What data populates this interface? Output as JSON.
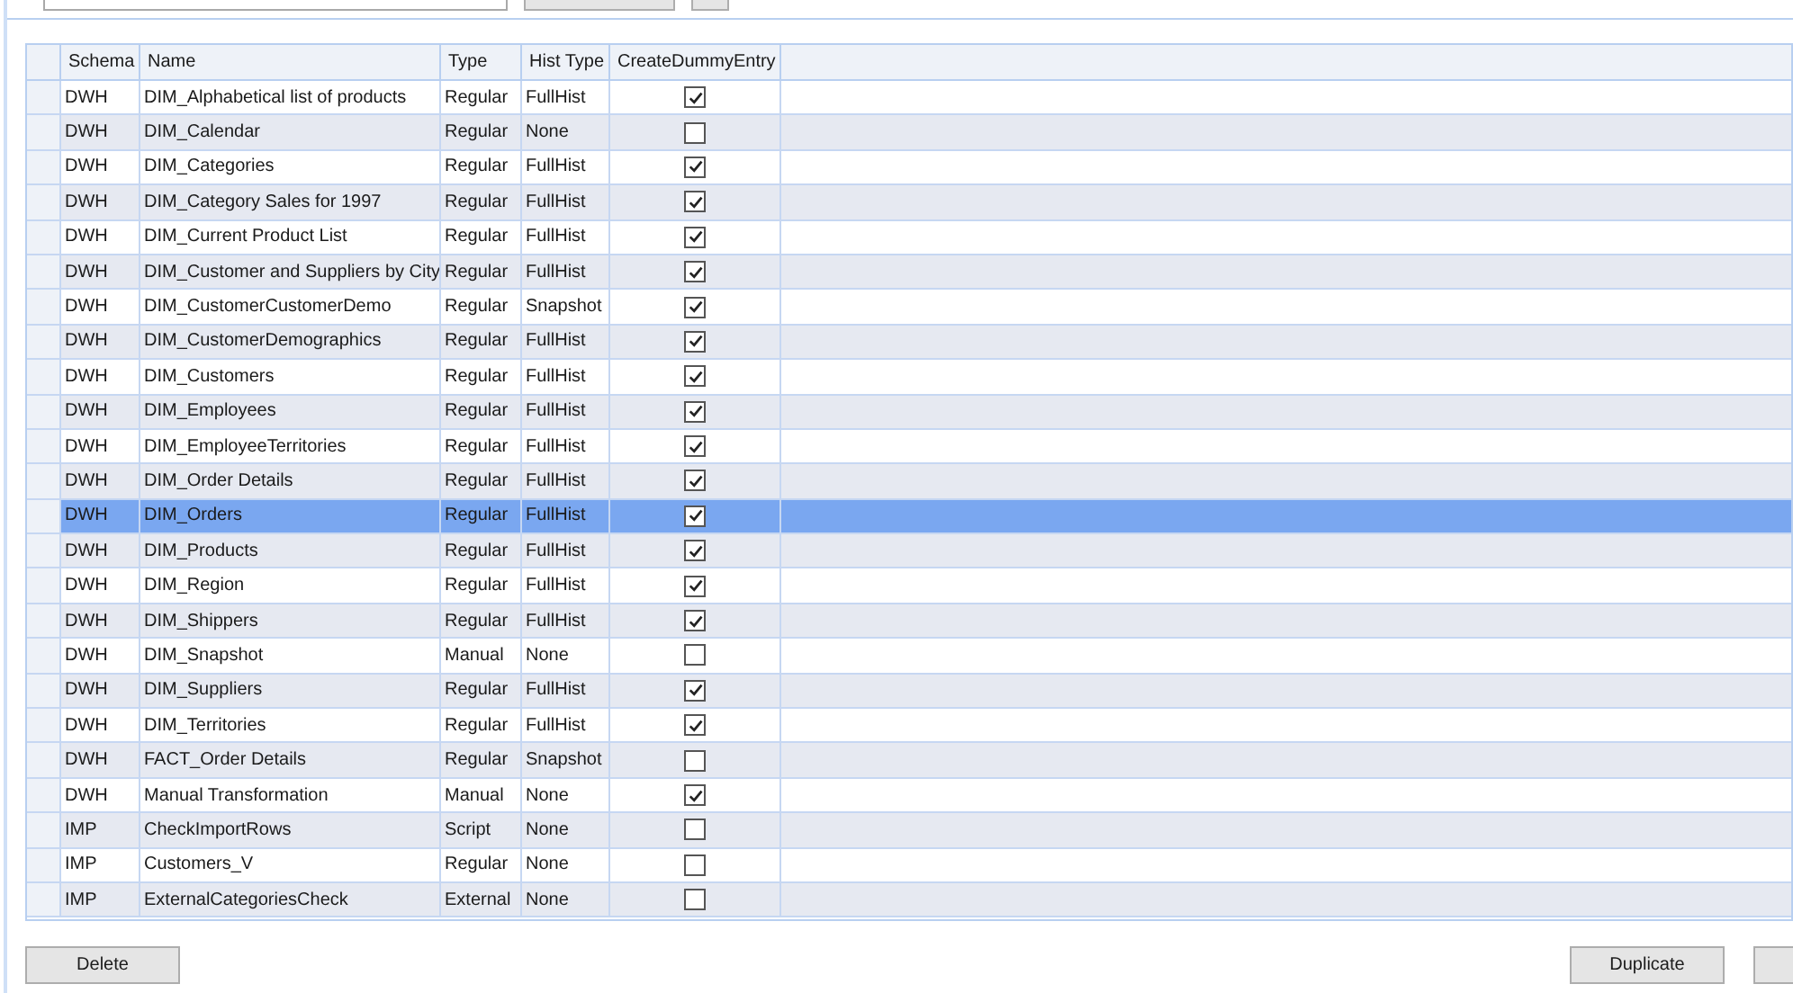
{
  "table": {
    "columns": [
      "Schema",
      "Name",
      "Type",
      "Hist Type",
      "CreateDummyEntry"
    ],
    "rows": [
      {
        "schema": "DWH",
        "name": "DIM_Alphabetical list of products",
        "type": "Regular",
        "hist_type": "FullHist",
        "create_dummy_entry": true,
        "selected": false
      },
      {
        "schema": "DWH",
        "name": "DIM_Calendar",
        "type": "Regular",
        "hist_type": "None",
        "create_dummy_entry": false,
        "selected": false
      },
      {
        "schema": "DWH",
        "name": "DIM_Categories",
        "type": "Regular",
        "hist_type": "FullHist",
        "create_dummy_entry": true,
        "selected": false
      },
      {
        "schema": "DWH",
        "name": "DIM_Category Sales for 1997",
        "type": "Regular",
        "hist_type": "FullHist",
        "create_dummy_entry": true,
        "selected": false
      },
      {
        "schema": "DWH",
        "name": "DIM_Current Product List",
        "type": "Regular",
        "hist_type": "FullHist",
        "create_dummy_entry": true,
        "selected": false
      },
      {
        "schema": "DWH",
        "name": "DIM_Customer and Suppliers by City",
        "type": "Regular",
        "hist_type": "FullHist",
        "create_dummy_entry": true,
        "selected": false
      },
      {
        "schema": "DWH",
        "name": "DIM_CustomerCustomerDemo",
        "type": "Regular",
        "hist_type": "Snapshot",
        "create_dummy_entry": true,
        "selected": false
      },
      {
        "schema": "DWH",
        "name": "DIM_CustomerDemographics",
        "type": "Regular",
        "hist_type": "FullHist",
        "create_dummy_entry": true,
        "selected": false
      },
      {
        "schema": "DWH",
        "name": "DIM_Customers",
        "type": "Regular",
        "hist_type": "FullHist",
        "create_dummy_entry": true,
        "selected": false
      },
      {
        "schema": "DWH",
        "name": "DIM_Employees",
        "type": "Regular",
        "hist_type": "FullHist",
        "create_dummy_entry": true,
        "selected": false
      },
      {
        "schema": "DWH",
        "name": "DIM_EmployeeTerritories",
        "type": "Regular",
        "hist_type": "FullHist",
        "create_dummy_entry": true,
        "selected": false
      },
      {
        "schema": "DWH",
        "name": "DIM_Order Details",
        "type": "Regular",
        "hist_type": "FullHist",
        "create_dummy_entry": true,
        "selected": false
      },
      {
        "schema": "DWH",
        "name": "DIM_Orders",
        "type": "Regular",
        "hist_type": "FullHist",
        "create_dummy_entry": true,
        "selected": true
      },
      {
        "schema": "DWH",
        "name": "DIM_Products",
        "type": "Regular",
        "hist_type": "FullHist",
        "create_dummy_entry": true,
        "selected": false
      },
      {
        "schema": "DWH",
        "name": "DIM_Region",
        "type": "Regular",
        "hist_type": "FullHist",
        "create_dummy_entry": true,
        "selected": false
      },
      {
        "schema": "DWH",
        "name": "DIM_Shippers",
        "type": "Regular",
        "hist_type": "FullHist",
        "create_dummy_entry": true,
        "selected": false
      },
      {
        "schema": "DWH",
        "name": "DIM_Snapshot",
        "type": "Manual",
        "hist_type": "None",
        "create_dummy_entry": false,
        "selected": false
      },
      {
        "schema": "DWH",
        "name": "DIM_Suppliers",
        "type": "Regular",
        "hist_type": "FullHist",
        "create_dummy_entry": true,
        "selected": false
      },
      {
        "schema": "DWH",
        "name": "DIM_Territories",
        "type": "Regular",
        "hist_type": "FullHist",
        "create_dummy_entry": true,
        "selected": false
      },
      {
        "schema": "DWH",
        "name": "FACT_Order Details",
        "type": "Regular",
        "hist_type": "Snapshot",
        "create_dummy_entry": false,
        "selected": false
      },
      {
        "schema": "DWH",
        "name": "Manual Transformation",
        "type": "Manual",
        "hist_type": "None",
        "create_dummy_entry": true,
        "selected": false
      },
      {
        "schema": "IMP",
        "name": "CheckImportRows",
        "type": "Script",
        "hist_type": "None",
        "create_dummy_entry": false,
        "selected": false
      },
      {
        "schema": "IMP",
        "name": "Customers_V",
        "type": "Regular",
        "hist_type": "None",
        "create_dummy_entry": false,
        "selected": false
      },
      {
        "schema": "IMP",
        "name": "ExternalCategoriesCheck",
        "type": "External",
        "hist_type": "None",
        "create_dummy_entry": false,
        "selected": false
      }
    ]
  },
  "buttons": [
    "Delete",
    "Duplicate"
  ]
}
